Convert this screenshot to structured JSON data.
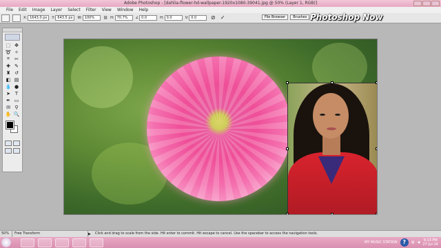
{
  "window": {
    "title": "Adobe Photoshop - [dahlia-flower-hd-wallpaper-1920x1080-39041.jpg @ 50% (Layer 1, RGB)]"
  },
  "menu": [
    "File",
    "Edit",
    "Image",
    "Layer",
    "Select",
    "Filter",
    "View",
    "Window",
    "Help"
  ],
  "options": {
    "x_label": "X:",
    "x_value": "1643.0 px",
    "y_label": "Y:",
    "y_value": "643.5 px",
    "w_label": "W:",
    "w_value": "100%",
    "h_label": "H:",
    "h_value": "70.7%",
    "angle_value": "0.0",
    "h_skew_label": "H:",
    "h_skew_value": "0.0",
    "v_skew_label": "V:",
    "v_skew_value": "0.0",
    "cancel_symbol": "⊘",
    "commit_symbol": "✓"
  },
  "well_tabs": [
    "File Browser",
    "Brushes"
  ],
  "watermark": "Photoshop Now",
  "status": {
    "zoom": "50%",
    "document": "Free Transform",
    "message": "Click and drag to scale from the side. Hit enter to commit. Hit escape to cancel. Use the spacebar to access the navigation tools."
  },
  "taskbar": {
    "tray_label": "MY MUSIC STATION",
    "time": "9:13 PM",
    "date": "27-Jul-16"
  },
  "colors": {
    "title_bar": "#e7a9c3",
    "taskbar": "#d98fb0",
    "canvas_bg": "#b8b8b8"
  }
}
